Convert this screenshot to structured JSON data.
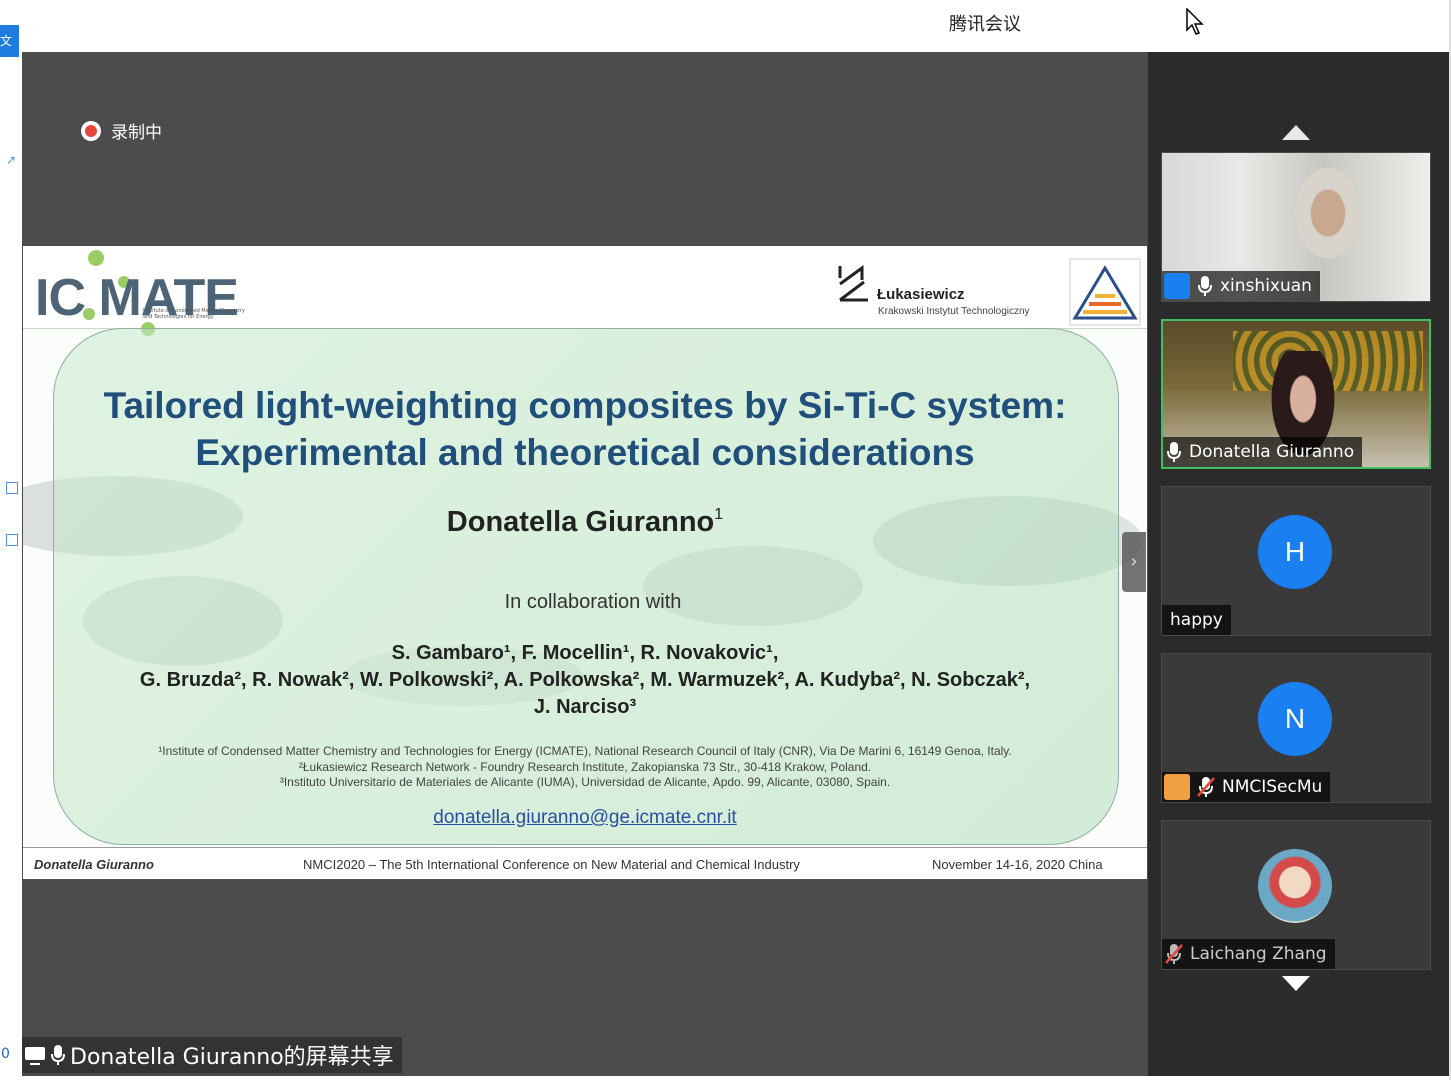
{
  "window": {
    "app_title": "腾讯会议"
  },
  "left_strip": {
    "tab_label": "文件",
    "bottom_digit": "0"
  },
  "recording": {
    "label": "录制中"
  },
  "slide": {
    "logo_left": "IC MATE",
    "logo_left_sub": "Institute of Condensed Matter Chemistry and Technologies for Energy",
    "logo_right_name": "Łukasiewicz",
    "logo_right_sub": "Krakowski Instytut Technologiczny",
    "title_line1": "Tailored light-weighting composites by Si-Ti-C system:",
    "title_line2": "Experimental and theoretical considerations",
    "author": "Donatella Giuranno",
    "author_sup": "1",
    "collab": "In collaboration with",
    "names_line1": "S. Gambaro¹, F. Mocellin¹, R. Novakovic¹,",
    "names_line2": "G. Bruzda², R. Nowak², W. Polkowski², A. Polkowska², M. Warmuzek², A. Kudyba², N. Sobczak²,",
    "names_line3": "J. Narciso³",
    "affil1": "¹Institute of Condensed Matter Chemistry and Technologies for Energy (ICMATE), National Research Council of Italy (CNR), Via De Marini 6, 16149 Genoa, Italy.",
    "affil2": "²Łukasiewicz Research Network - Foundry Research Institute, Zakopianska 73 Str., 30-418 Krakow, Poland.",
    "affil3": "³Instituto Universitario de Materiales de Alicante (IUMA), Universidad de Alicante, Apdo. 99, Alicante, 03080, Spain.",
    "email": "donatella.giuranno@ge.icmate.cnr.it",
    "footer_left": "Donatella Giuranno",
    "footer_center": "NMCI2020 – The 5th International Conference on New Material and Chemical Industry",
    "footer_right": "November 14-16, 2020 China"
  },
  "share_label": "Donatella Giuranno的屏幕共享",
  "participants": [
    {
      "name": "xinshixuan",
      "type": "video",
      "mic": "on",
      "host_badge": true
    },
    {
      "name": "Donatella Giuranno",
      "type": "video",
      "mic": "on",
      "active": true
    },
    {
      "name": "happy",
      "type": "avatar",
      "letter": "H"
    },
    {
      "name": "NMCISecMu",
      "type": "avatar",
      "letter": "N",
      "mic": "muted",
      "host_badge": true
    },
    {
      "name": "Laichang Zhang",
      "type": "photo",
      "mic": "muted"
    }
  ],
  "colors": {
    "accent_blue": "#1a7ff0",
    "active_border": "#3fbf5f",
    "record_red": "#e8463a",
    "title_blue": "#1f4f7a"
  }
}
